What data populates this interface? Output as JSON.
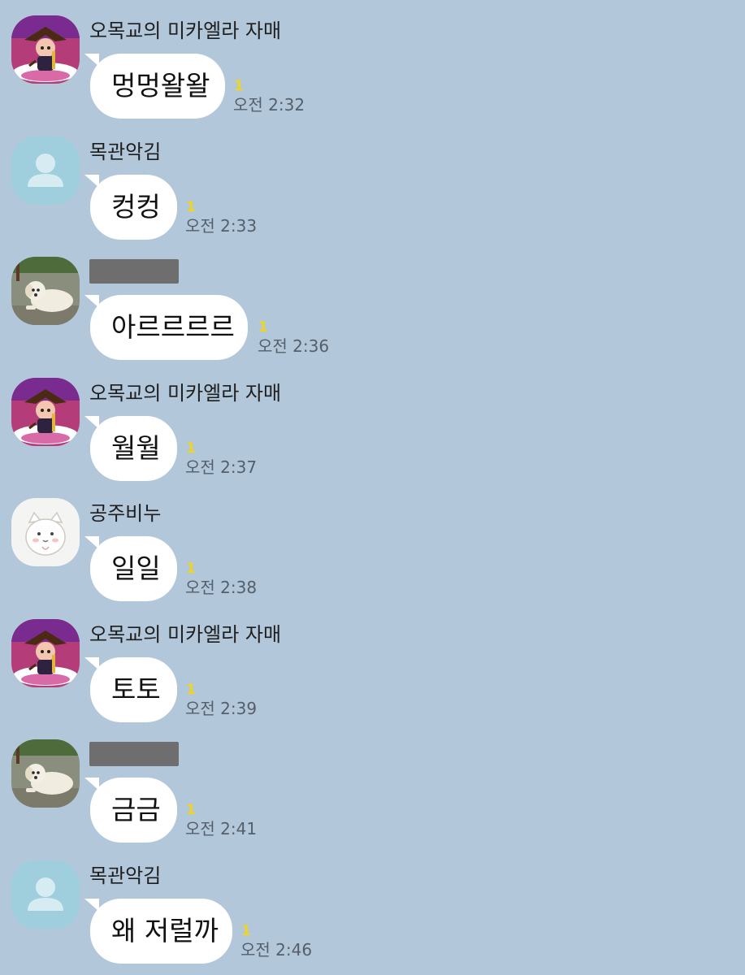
{
  "messages": [
    {
      "sender": "오목교의 미카엘라 자매",
      "sender_redacted": false,
      "avatar": "pirate-character-icon",
      "text": "멍멍왈왈",
      "unread": "1",
      "time": "오전 2:32"
    },
    {
      "sender": "목관악김",
      "sender_redacted": false,
      "avatar": "default-profile-icon",
      "text": "컹컹",
      "unread": "1",
      "time": "오전 2:33"
    },
    {
      "sender": "",
      "sender_redacted": true,
      "avatar": "puppy-photo-icon",
      "text": "아르르르르",
      "unread": "1",
      "time": "오전 2:36"
    },
    {
      "sender": "오목교의 미카엘라 자매",
      "sender_redacted": false,
      "avatar": "pirate-character-icon",
      "text": "월월",
      "unread": "1",
      "time": "오전 2:37"
    },
    {
      "sender": "공주비누",
      "sender_redacted": false,
      "avatar": "white-cat-icon",
      "text": "일일",
      "unread": "1",
      "time": "오전 2:38"
    },
    {
      "sender": "오목교의 미카엘라 자매",
      "sender_redacted": false,
      "avatar": "pirate-character-icon",
      "text": "토토",
      "unread": "1",
      "time": "오전 2:39"
    },
    {
      "sender": "",
      "sender_redacted": true,
      "avatar": "puppy-photo-icon",
      "text": "금금",
      "unread": "1",
      "time": "오전 2:41"
    },
    {
      "sender": "목관악김",
      "sender_redacted": false,
      "avatar": "default-profile-icon",
      "text": "왜 저럴까",
      "unread": "1",
      "time": "오전 2:46"
    }
  ],
  "colors": {
    "background": "#b2c7da",
    "bubble": "#ffffff",
    "unread_count": "#f2d51a",
    "timestamp": "#555f6a"
  }
}
